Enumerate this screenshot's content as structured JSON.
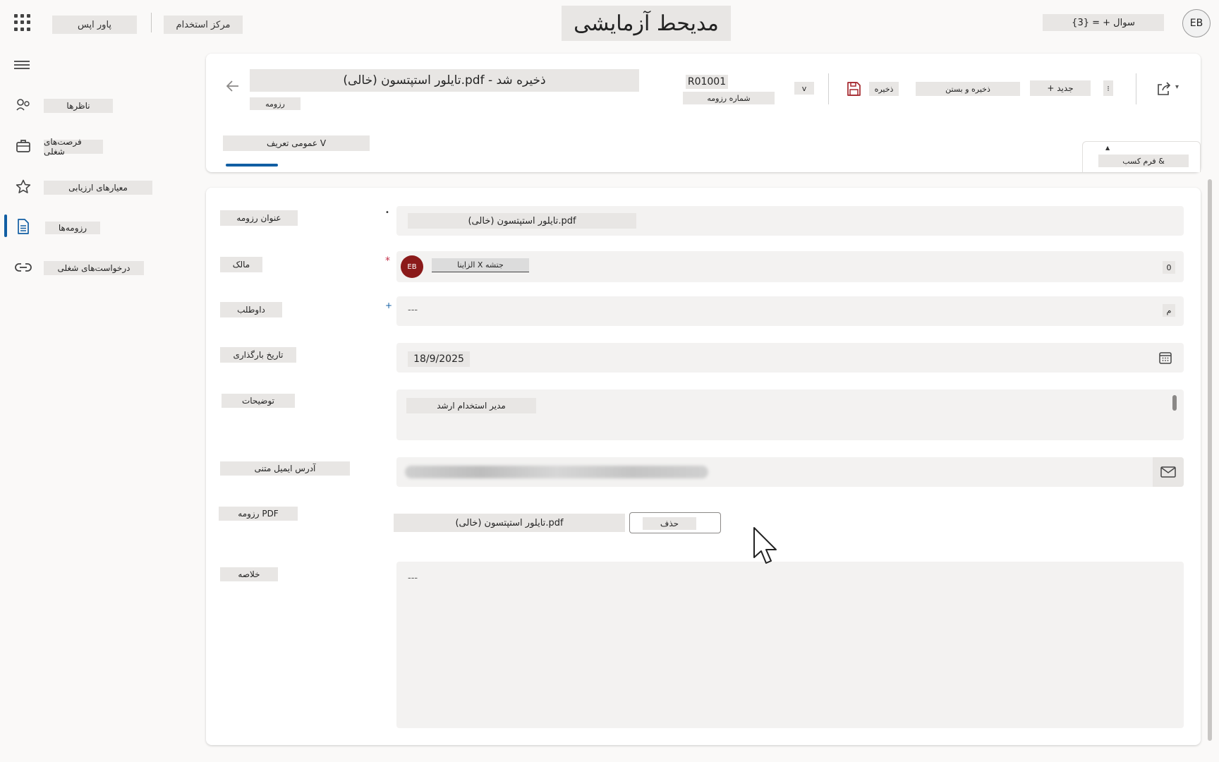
{
  "topbar": {
    "app_title": "مدیحط آزمایشی",
    "btn_1": "پاور اپس",
    "btn_2": "مرکز استخدام",
    "search": "سوال + = {3}",
    "avatar": "EB"
  },
  "nav": {
    "items": [
      {
        "label": "ناظرها",
        "icon": "people-icon"
      },
      {
        "label": "فرصت‌های شغلی",
        "icon": "briefcase-icon"
      },
      {
        "label": "معیارهای ارزیابی",
        "icon": "star-icon"
      },
      {
        "label": "رزومه‌ها",
        "icon": "document-icon"
      },
      {
        "label": "درخواست‌های شغلی",
        "icon": "link-icon"
      }
    ]
  },
  "header": {
    "title": "تایلور استپتسون (خالی).pdf - ذخیره شد",
    "record_type": "رزومه",
    "record_id": "R01001",
    "record_id_label": "شماره رزومه",
    "chevron": "v",
    "save_label": "ذخیره",
    "save_close_label": "ذخیره و بستن",
    "new_label": "+ جدید",
    "more_label": "⁝",
    "tab_general": "عمومی تعریف V",
    "side_tab_label": "فرم کسب &"
  },
  "form": {
    "resume_title_label": "عنوان رزومه",
    "resume_title_value": "تایلور استپتسون (خالی).pdf",
    "owner_label": "مالک",
    "owner_avatar": "EB",
    "owner_value": "الزاینا X جتشه",
    "owner_count": "0",
    "candidate_label": "داوطلب",
    "candidate_value": "---",
    "candidate_btn": "م",
    "upload_date_label": "تاریخ بارگذاری",
    "upload_date_value": "18/9/2025",
    "description_label": "توضیحات",
    "description_value": "مدیر استخدام ارشد",
    "email_label": "آدرس ایمیل متنی",
    "pdf_label": "رزومه PDF",
    "pdf_name": "تایلور استپتسون (خالی).pdf",
    "pdf_delete": "حذف",
    "summary_label": "خلاصه",
    "summary_value": "---"
  }
}
